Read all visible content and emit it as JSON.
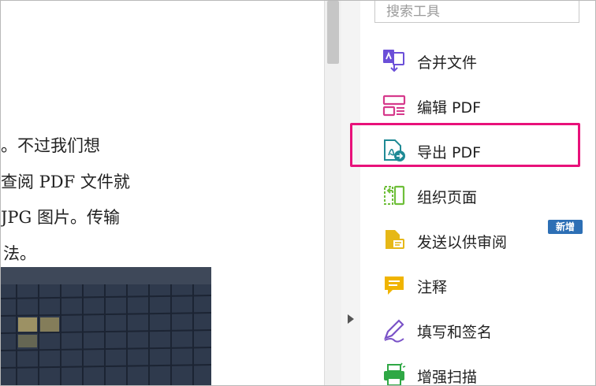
{
  "document": {
    "lines": [
      "。不过我们想",
      "查阅 PDF 文件就",
      "JPG 图片。传输",
      "法。"
    ]
  },
  "search": {
    "placeholder": "搜索工具"
  },
  "tools": [
    {
      "label": "合并文件",
      "icon": "combine-files-icon"
    },
    {
      "label": "编辑 PDF",
      "icon": "edit-pdf-icon"
    },
    {
      "label": "导出 PDF",
      "icon": "export-pdf-icon"
    },
    {
      "label": "组织页面",
      "icon": "organize-pages-icon"
    },
    {
      "label": "发送以供审阅",
      "icon": "send-for-review-icon",
      "badge": "新增"
    },
    {
      "label": "注释",
      "icon": "comment-icon"
    },
    {
      "label": "填写和签名",
      "icon": "fill-sign-icon"
    },
    {
      "label": "增强扫描",
      "icon": "enhance-scans-icon"
    }
  ],
  "colors": {
    "highlight": "#e8117a",
    "badge": "#2d6fb5",
    "combine": "#6b4fd8",
    "edit": "#d63a8c",
    "export": "#1f8a95",
    "organize": "#6fbf3a",
    "review": "#e6b817",
    "comment": "#f0b400",
    "sign": "#7a52c7",
    "scan": "#2fa845"
  }
}
